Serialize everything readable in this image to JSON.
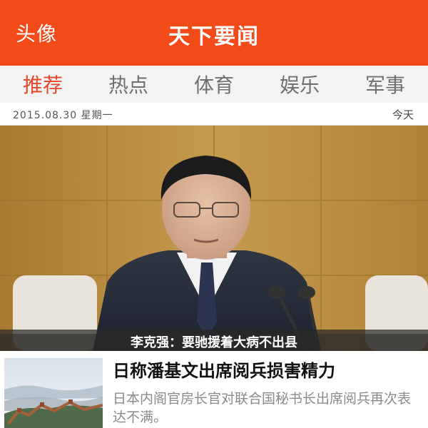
{
  "header": {
    "avatar_label": "头像",
    "title": "天下要闻",
    "background_color": "#f34a1a"
  },
  "tabs": [
    {
      "label": "推荐",
      "active": true
    },
    {
      "label": "热点",
      "active": false
    },
    {
      "label": "体育",
      "active": false
    },
    {
      "label": "娱乐",
      "active": false
    },
    {
      "label": "军事",
      "active": false
    }
  ],
  "date_bar": {
    "date": "2015.08.30 星期一",
    "today_label": "今天"
  },
  "hero": {
    "caption": "李克强：要驰援着大病不出县"
  },
  "news_list": [
    {
      "title": "日称潘基文出席阅兵损害精力",
      "summary": "日本内阁官房长官对联合国秘书长出席阅兵再次表达不满。",
      "thumbnail": "great-wall-landscape"
    }
  ],
  "colors": {
    "accent": "#e8462b",
    "tab_inactive": "#6f6f6f"
  }
}
